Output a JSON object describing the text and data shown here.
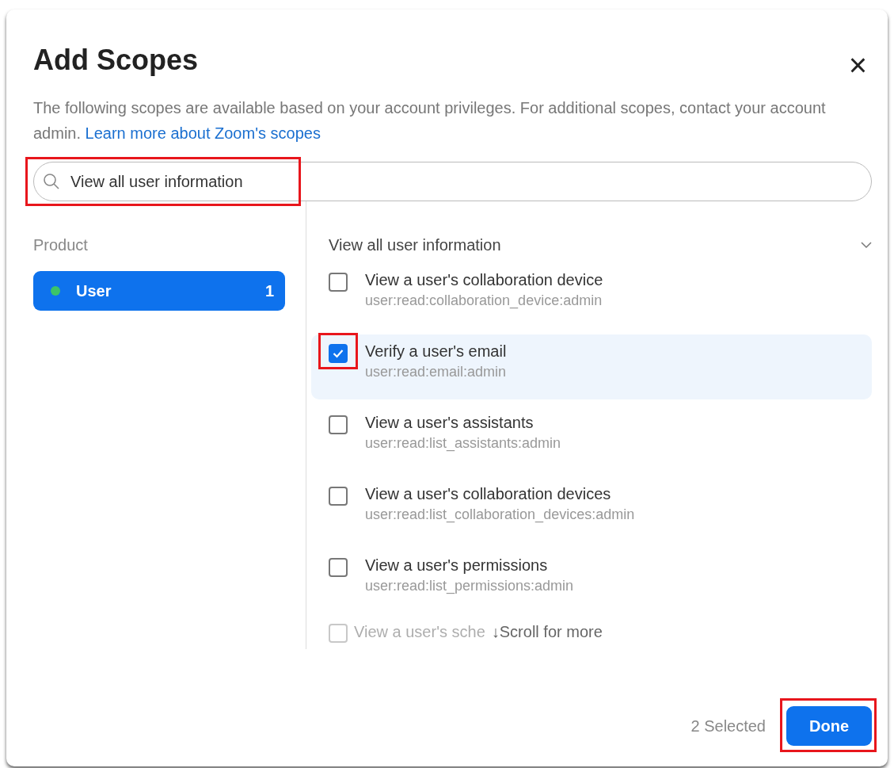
{
  "dialog": {
    "title": "Add Scopes",
    "close": "×",
    "description": "The following scopes are available based on your account privileges. For additional scopes, contact your account admin. ",
    "learn_more_link": "Learn more about Zoom's scopes"
  },
  "search": {
    "value": "View all user information",
    "highlighted": true
  },
  "sidebar": {
    "heading": "Product",
    "items": [
      {
        "label": "User",
        "count": "1",
        "color": "#3cc468",
        "selected": true
      }
    ]
  },
  "scope_group": {
    "title": "View all user information",
    "expanded": true
  },
  "scopes": [
    {
      "name": "View a user's collaboration device",
      "id": "user:read:collaboration_device:admin",
      "checked": false,
      "highlighted": false
    },
    {
      "name": "Verify a user's email",
      "id": "user:read:email:admin",
      "checked": true,
      "highlighted": true
    },
    {
      "name": "View a user's assistants",
      "id": "user:read:list_assistants:admin",
      "checked": false,
      "highlighted": false
    },
    {
      "name": "View a user's collaboration devices",
      "id": "user:read:list_collaboration_devices:admin",
      "checked": false,
      "highlighted": false
    },
    {
      "name": "View a user's permissions",
      "id": "user:read:list_permissions:admin",
      "checked": false,
      "highlighted": false
    }
  ],
  "faded_scope": {
    "name": "View a user's sche",
    "checked": false
  },
  "scroll_hint": "↓Scroll for more",
  "footer": {
    "selected_count": "2 Selected",
    "done_button": "Done",
    "done_highlighted": true
  }
}
